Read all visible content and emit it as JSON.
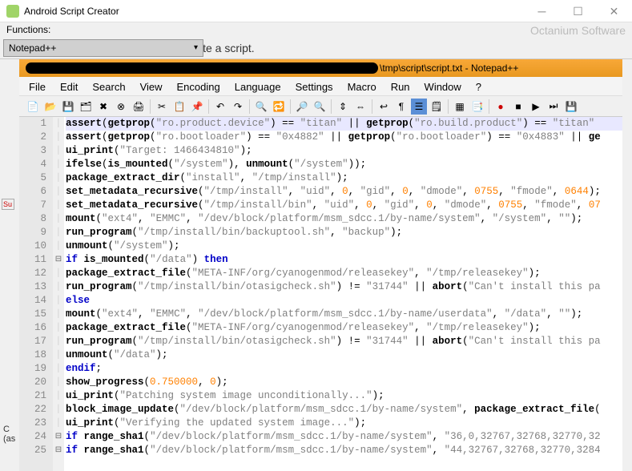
{
  "titlebar": {
    "title": "Android Script Creator"
  },
  "functions_label": "Functions:",
  "dropdown_value": "Notepad++",
  "hint": "ite a script.",
  "brand": "Octanium Software",
  "subtitle_suffix": "\\tmp\\script\\script.txt - Notepad++",
  "menu": [
    "File",
    "Edit",
    "Search",
    "View",
    "Encoding",
    "Language",
    "Settings",
    "Macro",
    "Run",
    "Window",
    "?"
  ],
  "side_label1": "Su",
  "side_label2": "C",
  "side_label3": "(as",
  "code_lines": [
    {
      "n": 1,
      "hl": true,
      "seg": [
        [
          "fn",
          "assert"
        ],
        [
          "op",
          "("
        ],
        [
          "fn",
          "getprop"
        ],
        [
          "op",
          "("
        ],
        [
          "str",
          "\"ro.product.device\""
        ],
        [
          "op",
          ") == "
        ],
        [
          "str",
          "\"titan\""
        ],
        [
          "op",
          " || "
        ],
        [
          "fn",
          "getprop"
        ],
        [
          "op",
          "("
        ],
        [
          "str",
          "\"ro.build.product\""
        ],
        [
          "op",
          ") == "
        ],
        [
          "str",
          "\"titan\""
        ]
      ]
    },
    {
      "n": 2,
      "seg": [
        [
          "fn",
          "assert"
        ],
        [
          "op",
          "("
        ],
        [
          "fn",
          "getprop"
        ],
        [
          "op",
          "("
        ],
        [
          "str",
          "\"ro.bootloader\""
        ],
        [
          "op",
          ") == "
        ],
        [
          "str",
          "\"0x4882\""
        ],
        [
          "op",
          " || "
        ],
        [
          "fn",
          "getprop"
        ],
        [
          "op",
          "("
        ],
        [
          "str",
          "\"ro.bootloader\""
        ],
        [
          "op",
          ") == "
        ],
        [
          "str",
          "\"0x4883\""
        ],
        [
          "op",
          " || "
        ],
        [
          "fn",
          "ge"
        ]
      ]
    },
    {
      "n": 3,
      "seg": [
        [
          "fn",
          "ui_print"
        ],
        [
          "op",
          "("
        ],
        [
          "str",
          "\"Target: 1466434810\""
        ],
        [
          "op",
          ");"
        ]
      ]
    },
    {
      "n": 4,
      "seg": [
        [
          "fn",
          "ifelse"
        ],
        [
          "op",
          "("
        ],
        [
          "fn",
          "is_mounted"
        ],
        [
          "op",
          "("
        ],
        [
          "str",
          "\"/system\""
        ],
        [
          "op",
          "), "
        ],
        [
          "fn",
          "unmount"
        ],
        [
          "op",
          "("
        ],
        [
          "str",
          "\"/system\""
        ],
        [
          "op",
          "));"
        ]
      ]
    },
    {
      "n": 5,
      "seg": [
        [
          "fn",
          "package_extract_dir"
        ],
        [
          "op",
          "("
        ],
        [
          "str",
          "\"install\""
        ],
        [
          "op",
          ", "
        ],
        [
          "str",
          "\"/tmp/install\""
        ],
        [
          "op",
          ");"
        ]
      ]
    },
    {
      "n": 6,
      "seg": [
        [
          "fn",
          "set_metadata_recursive"
        ],
        [
          "op",
          "("
        ],
        [
          "str",
          "\"/tmp/install\""
        ],
        [
          "op",
          ", "
        ],
        [
          "str",
          "\"uid\""
        ],
        [
          "op",
          ", "
        ],
        [
          "num",
          "0"
        ],
        [
          "op",
          ", "
        ],
        [
          "str",
          "\"gid\""
        ],
        [
          "op",
          ", "
        ],
        [
          "num",
          "0"
        ],
        [
          "op",
          ", "
        ],
        [
          "str",
          "\"dmode\""
        ],
        [
          "op",
          ", "
        ],
        [
          "num",
          "0755"
        ],
        [
          "op",
          ", "
        ],
        [
          "str",
          "\"fmode\""
        ],
        [
          "op",
          ", "
        ],
        [
          "num",
          "0644"
        ],
        [
          "op",
          ");"
        ]
      ]
    },
    {
      "n": 7,
      "seg": [
        [
          "fn",
          "set_metadata_recursive"
        ],
        [
          "op",
          "("
        ],
        [
          "str",
          "\"/tmp/install/bin\""
        ],
        [
          "op",
          ", "
        ],
        [
          "str",
          "\"uid\""
        ],
        [
          "op",
          ", "
        ],
        [
          "num",
          "0"
        ],
        [
          "op",
          ", "
        ],
        [
          "str",
          "\"gid\""
        ],
        [
          "op",
          ", "
        ],
        [
          "num",
          "0"
        ],
        [
          "op",
          ", "
        ],
        [
          "str",
          "\"dmode\""
        ],
        [
          "op",
          ", "
        ],
        [
          "num",
          "0755"
        ],
        [
          "op",
          ", "
        ],
        [
          "str",
          "\"fmode\""
        ],
        [
          "op",
          ", "
        ],
        [
          "num",
          "07"
        ]
      ]
    },
    {
      "n": 8,
      "seg": [
        [
          "fn",
          "mount"
        ],
        [
          "op",
          "("
        ],
        [
          "str",
          "\"ext4\""
        ],
        [
          "op",
          ", "
        ],
        [
          "str",
          "\"EMMC\""
        ],
        [
          "op",
          ", "
        ],
        [
          "str",
          "\"/dev/block/platform/msm_sdcc.1/by-name/system\""
        ],
        [
          "op",
          ", "
        ],
        [
          "str",
          "\"/system\""
        ],
        [
          "op",
          ", "
        ],
        [
          "str",
          "\"\""
        ],
        [
          "op",
          ");"
        ]
      ]
    },
    {
      "n": 9,
      "seg": [
        [
          "fn",
          "run_program"
        ],
        [
          "op",
          "("
        ],
        [
          "str",
          "\"/tmp/install/bin/backuptool.sh\""
        ],
        [
          "op",
          ", "
        ],
        [
          "str",
          "\"backup\""
        ],
        [
          "op",
          ");"
        ]
      ]
    },
    {
      "n": 10,
      "seg": [
        [
          "fn",
          "unmount"
        ],
        [
          "op",
          "("
        ],
        [
          "str",
          "\"/system\""
        ],
        [
          "op",
          ");"
        ]
      ]
    },
    {
      "n": 11,
      "fold": "⊟",
      "seg": [
        [
          "kw",
          "if"
        ],
        [
          "op",
          " "
        ],
        [
          "fn",
          "is_mounted"
        ],
        [
          "op",
          "("
        ],
        [
          "str",
          "\"/data\""
        ],
        [
          "op",
          ") "
        ],
        [
          "kw",
          "then"
        ]
      ]
    },
    {
      "n": 12,
      "seg": [
        [
          "fn",
          "package_extract_file"
        ],
        [
          "op",
          "("
        ],
        [
          "str",
          "\"META-INF/org/cyanogenmod/releasekey\""
        ],
        [
          "op",
          ", "
        ],
        [
          "str",
          "\"/tmp/releasekey\""
        ],
        [
          "op",
          ");"
        ]
      ]
    },
    {
      "n": 13,
      "seg": [
        [
          "fn",
          "run_program"
        ],
        [
          "op",
          "("
        ],
        [
          "str",
          "\"/tmp/install/bin/otasigcheck.sh\""
        ],
        [
          "op",
          ") != "
        ],
        [
          "str",
          "\"31744\""
        ],
        [
          "op",
          " || "
        ],
        [
          "fn",
          "abort"
        ],
        [
          "op",
          "("
        ],
        [
          "str",
          "\"Can't install this pa"
        ]
      ]
    },
    {
      "n": 14,
      "seg": [
        [
          "kw",
          "else"
        ]
      ]
    },
    {
      "n": 15,
      "seg": [
        [
          "fn",
          "mount"
        ],
        [
          "op",
          "("
        ],
        [
          "str",
          "\"ext4\""
        ],
        [
          "op",
          ", "
        ],
        [
          "str",
          "\"EMMC\""
        ],
        [
          "op",
          ", "
        ],
        [
          "str",
          "\"/dev/block/platform/msm_sdcc.1/by-name/userdata\""
        ],
        [
          "op",
          ", "
        ],
        [
          "str",
          "\"/data\""
        ],
        [
          "op",
          ", "
        ],
        [
          "str",
          "\"\""
        ],
        [
          "op",
          ");"
        ]
      ]
    },
    {
      "n": 16,
      "seg": [
        [
          "fn",
          "package_extract_file"
        ],
        [
          "op",
          "("
        ],
        [
          "str",
          "\"META-INF/org/cyanogenmod/releasekey\""
        ],
        [
          "op",
          ", "
        ],
        [
          "str",
          "\"/tmp/releasekey\""
        ],
        [
          "op",
          ");"
        ]
      ]
    },
    {
      "n": 17,
      "seg": [
        [
          "fn",
          "run_program"
        ],
        [
          "op",
          "("
        ],
        [
          "str",
          "\"/tmp/install/bin/otasigcheck.sh\""
        ],
        [
          "op",
          ") != "
        ],
        [
          "str",
          "\"31744\""
        ],
        [
          "op",
          " || "
        ],
        [
          "fn",
          "abort"
        ],
        [
          "op",
          "("
        ],
        [
          "str",
          "\"Can't install this pa"
        ]
      ]
    },
    {
      "n": 18,
      "seg": [
        [
          "fn",
          "unmount"
        ],
        [
          "op",
          "("
        ],
        [
          "str",
          "\"/data\""
        ],
        [
          "op",
          ");"
        ]
      ]
    },
    {
      "n": 19,
      "seg": [
        [
          "kw",
          "endif"
        ],
        [
          "op",
          ";"
        ]
      ]
    },
    {
      "n": 20,
      "seg": [
        [
          "fn",
          "show_progress"
        ],
        [
          "op",
          "("
        ],
        [
          "num",
          "0.750000"
        ],
        [
          "op",
          ", "
        ],
        [
          "num",
          "0"
        ],
        [
          "op",
          ");"
        ]
      ]
    },
    {
      "n": 21,
      "seg": [
        [
          "fn",
          "ui_print"
        ],
        [
          "op",
          "("
        ],
        [
          "str",
          "\"Patching system image unconditionally...\""
        ],
        [
          "op",
          ");"
        ]
      ]
    },
    {
      "n": 22,
      "seg": [
        [
          "fn",
          "block_image_update"
        ],
        [
          "op",
          "("
        ],
        [
          "str",
          "\"/dev/block/platform/msm_sdcc.1/by-name/system\""
        ],
        [
          "op",
          ", "
        ],
        [
          "fn",
          "package_extract_file"
        ],
        [
          "op",
          "("
        ]
      ]
    },
    {
      "n": 23,
      "seg": [
        [
          "fn",
          "ui_print"
        ],
        [
          "op",
          "("
        ],
        [
          "str",
          "\"Verifying the updated system image...\""
        ],
        [
          "op",
          ");"
        ]
      ]
    },
    {
      "n": 24,
      "fold": "⊟",
      "seg": [
        [
          "kw",
          "if"
        ],
        [
          "op",
          " "
        ],
        [
          "fn",
          "range_sha1"
        ],
        [
          "op",
          "("
        ],
        [
          "str",
          "\"/dev/block/platform/msm_sdcc.1/by-name/system\""
        ],
        [
          "op",
          ", "
        ],
        [
          "str",
          "\"36,0,32767,32768,32770,32"
        ]
      ]
    },
    {
      "n": 25,
      "fold": "⊟",
      "seg": [
        [
          "kw",
          "if"
        ],
        [
          "op",
          " "
        ],
        [
          "fn",
          "range_sha1"
        ],
        [
          "op",
          "("
        ],
        [
          "str",
          "\"/dev/block/platform/msm_sdcc.1/by-name/system\""
        ],
        [
          "op",
          ", "
        ],
        [
          "str",
          "\"44,32767,32768,32770,3284"
        ]
      ]
    }
  ]
}
